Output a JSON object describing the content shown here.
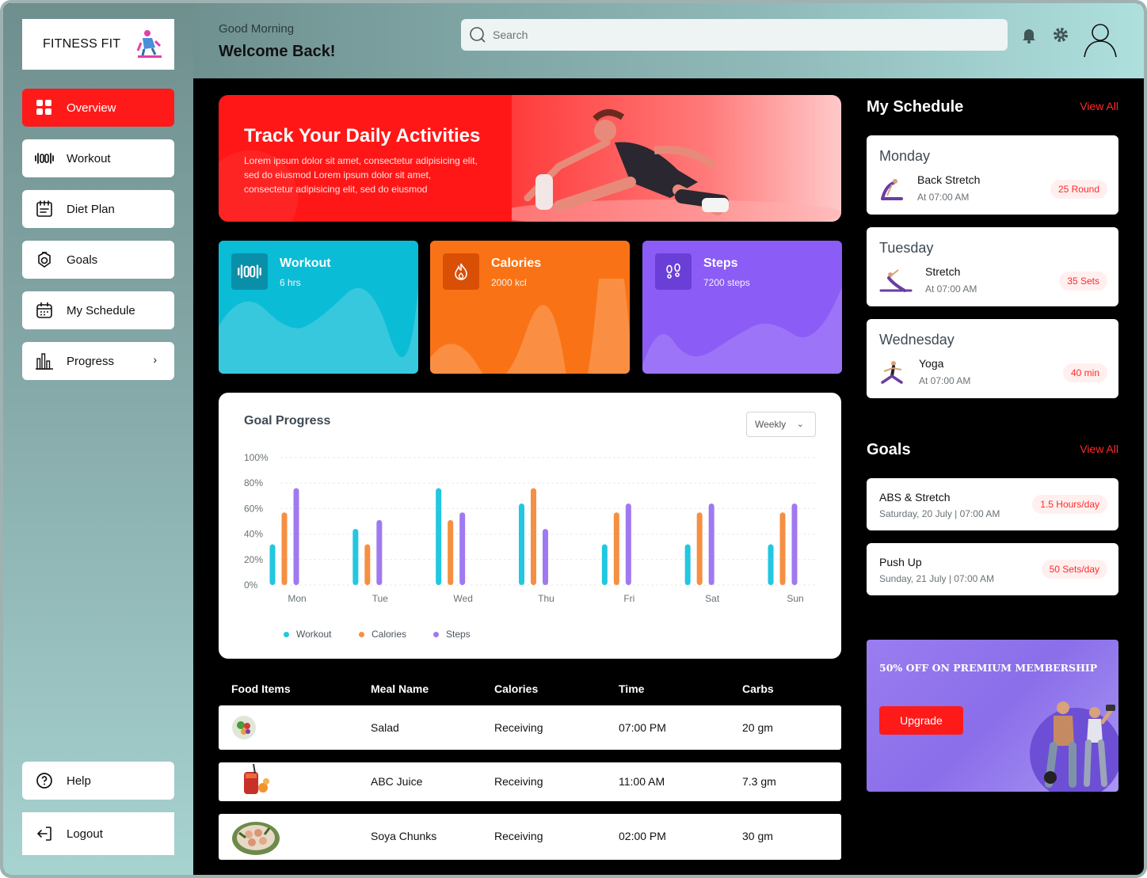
{
  "brand": {
    "name": "FITNESS FIT",
    "logo_sub": "FITNESS FIT"
  },
  "sidebar": {
    "items": [
      {
        "label": "Overview",
        "icon": "grid-icon",
        "active": true
      },
      {
        "label": "Workout",
        "icon": "dumbbell-icon"
      },
      {
        "label": "Diet Plan",
        "icon": "diet-icon"
      },
      {
        "label": "Goals",
        "icon": "goals-icon"
      },
      {
        "label": "My Schedule",
        "icon": "calendar-icon"
      },
      {
        "label": "Progress",
        "icon": "bar-chart-icon"
      }
    ],
    "help": "Help",
    "logout": "Logout"
  },
  "header": {
    "greeting": "Good Morning",
    "welcome": "Welcome Back!",
    "search_placeholder": "Search"
  },
  "hero": {
    "title": "Track Your Daily Activities",
    "text": "Lorem ipsum dolor sit amet, consectetur adipisicing elit, sed do eiusmod Lorem ipsum dolor sit amet, consectetur adipisicing elit, sed do eiusmod"
  },
  "stats": [
    {
      "title": "Workout",
      "value": "6 hrs",
      "color": "#0bbcd6",
      "icon": "dumbbell-icon"
    },
    {
      "title": "Calories",
      "value": "2000 kcl",
      "color": "#f97316",
      "icon": "flame-icon"
    },
    {
      "title": "Steps",
      "value": "7200 steps",
      "color": "#8b5cf6",
      "icon": "footsteps-icon"
    }
  ],
  "goal_progress": {
    "title": "Goal Progress",
    "period": "Weekly"
  },
  "chart_data": {
    "type": "bar",
    "categories": [
      "Mon",
      "Tue",
      "Wed",
      "Thu",
      "Fri",
      "Sat",
      "Sun"
    ],
    "ylim": [
      0,
      100
    ],
    "yticks": [
      "0%",
      "20%",
      "40%",
      "60%",
      "80%",
      "100%"
    ],
    "series": [
      {
        "name": "Workout",
        "color": "#22c7e0",
        "values": [
          32,
          44,
          76,
          64,
          32,
          32,
          32
        ]
      },
      {
        "name": "Calories",
        "color": "#f59042",
        "values": [
          57,
          32,
          51,
          76,
          57,
          57,
          57
        ]
      },
      {
        "name": "Steps",
        "color": "#a079f0",
        "values": [
          76,
          51,
          57,
          44,
          64,
          64,
          64
        ]
      }
    ]
  },
  "table": {
    "headers": [
      "Food Items",
      "Meal Name",
      "Calories",
      "Time",
      "Carbs"
    ],
    "rows": [
      {
        "meal": "Salad",
        "calories": "Receiving",
        "time": "07:00 PM",
        "carbs": "20 gm"
      },
      {
        "meal": "ABC Juice",
        "calories": "Receiving",
        "time": "11:00 AM",
        "carbs": "7.3 gm"
      },
      {
        "meal": "Soya Chunks",
        "calories": "Receiving",
        "time": "02:00 PM",
        "carbs": "30 gm"
      }
    ]
  },
  "schedule": {
    "title": "My Schedule",
    "view_all": "View All",
    "items": [
      {
        "day": "Monday",
        "activity": "Back Stretch",
        "time": "At 07:00 AM",
        "badge": "25 Round"
      },
      {
        "day": "Tuesday",
        "activity": "Stretch",
        "time": "At 07:00 AM",
        "badge": "35 Sets"
      },
      {
        "day": "Wednesday",
        "activity": "Yoga",
        "time": "At 07:00 AM",
        "badge": "40 min"
      }
    ]
  },
  "goals": {
    "title": "Goals",
    "view_all": "View All",
    "items": [
      {
        "name": "ABS & Stretch",
        "date": "Saturday, 20 July | 07:00 AM",
        "badge": "1.5 Hours/day"
      },
      {
        "name": "Push Up",
        "date": "Sunday, 21 July | 07:00 AM",
        "badge": "50 Sets/day"
      }
    ]
  },
  "promo": {
    "text": "50% OFF ON PREMIUM MEMBERSHIP",
    "button": "Upgrade"
  }
}
